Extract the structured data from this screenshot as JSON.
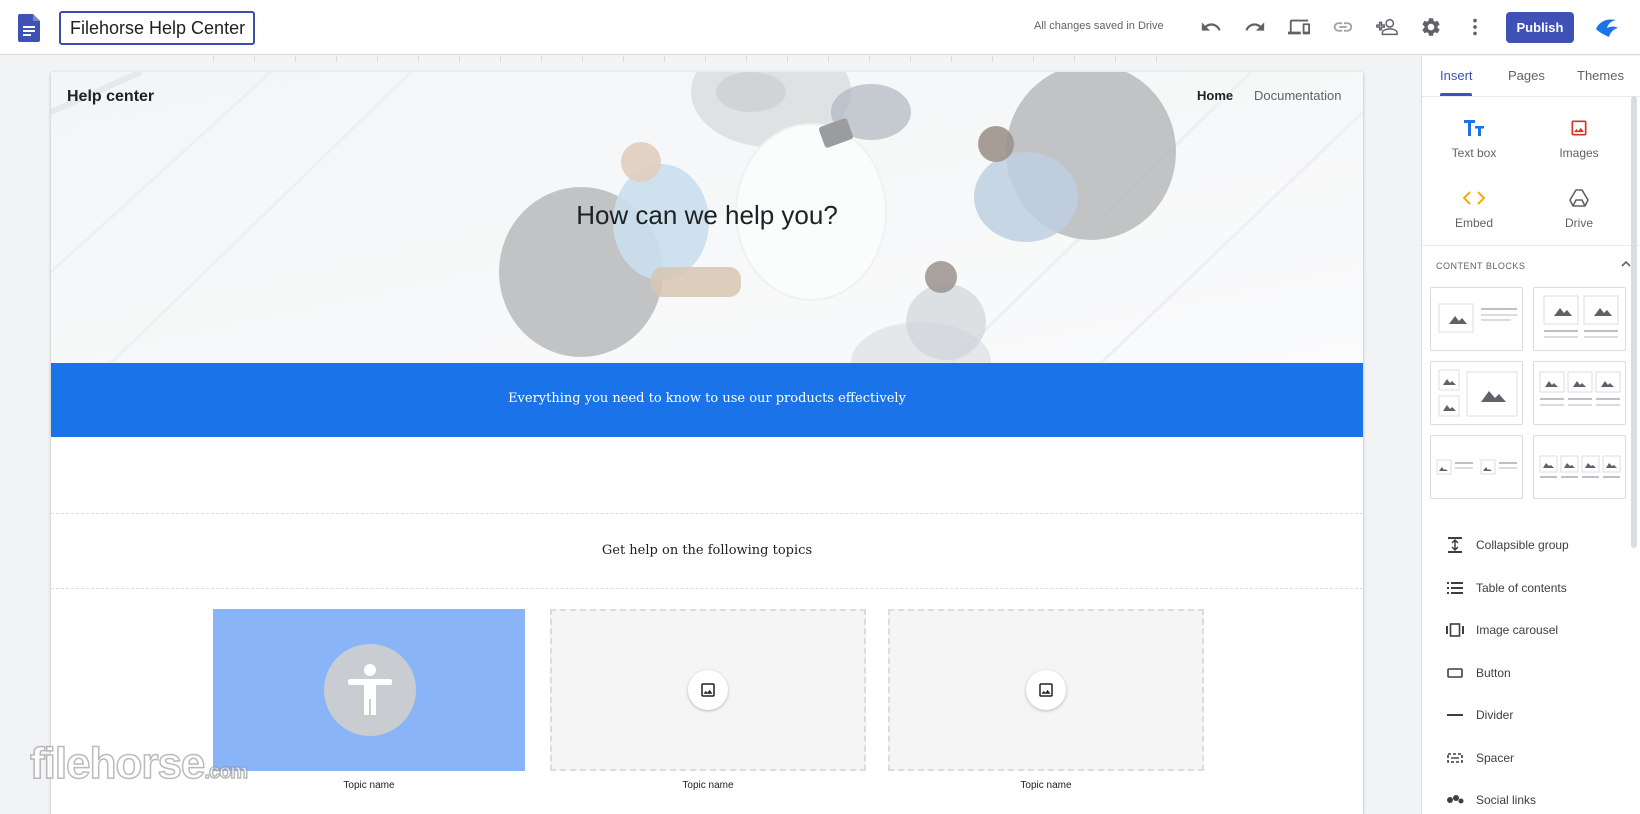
{
  "app": {
    "document_title": "Filehorse Help Center",
    "save_status": "All changes saved in Drive",
    "publish_label": "Publish"
  },
  "toolbar": {
    "icons": [
      "undo-icon",
      "redo-icon",
      "preview-icon",
      "link-icon",
      "share-icon",
      "settings-icon",
      "more-vert-icon"
    ]
  },
  "site": {
    "title": "Help center",
    "nav": [
      "Home",
      "Documentation"
    ],
    "hero_heading": "How can we help you?",
    "band_text": "Everything you need to know to use our products effectively",
    "topics_heading": "Get help on the following topics",
    "topics": [
      "Topic name",
      "Topic name",
      "Topic name"
    ]
  },
  "panel": {
    "tabs": [
      "Insert",
      "Pages",
      "Themes"
    ],
    "active_tab": "Insert",
    "insert_items": [
      {
        "label": "Text box",
        "icon": "text-box-icon",
        "color": "#1a73e8"
      },
      {
        "label": "Images",
        "icon": "image-icon",
        "color": "#d93025"
      },
      {
        "label": "Embed",
        "icon": "embed-icon",
        "color": "#f9ab00"
      },
      {
        "label": "Drive",
        "icon": "drive-icon",
        "color": "#5f6368"
      }
    ],
    "content_blocks_heading": "CONTENT BLOCKS",
    "list_items": [
      {
        "label": "Collapsible group",
        "icon": "collapsible-group-icon"
      },
      {
        "label": "Table of contents",
        "icon": "table-of-contents-icon"
      },
      {
        "label": "Image carousel",
        "icon": "image-carousel-icon"
      },
      {
        "label": "Button",
        "icon": "button-icon"
      },
      {
        "label": "Divider",
        "icon": "divider-icon"
      },
      {
        "label": "Spacer",
        "icon": "spacer-icon"
      },
      {
        "label": "Social links",
        "icon": "social-links-icon"
      }
    ]
  },
  "watermark": {
    "text": "filehorse",
    "suffix": ".com"
  },
  "colors": {
    "accent": "#3f51b5",
    "band": "#1a73e8",
    "topic_card": "#8ab4f8"
  }
}
